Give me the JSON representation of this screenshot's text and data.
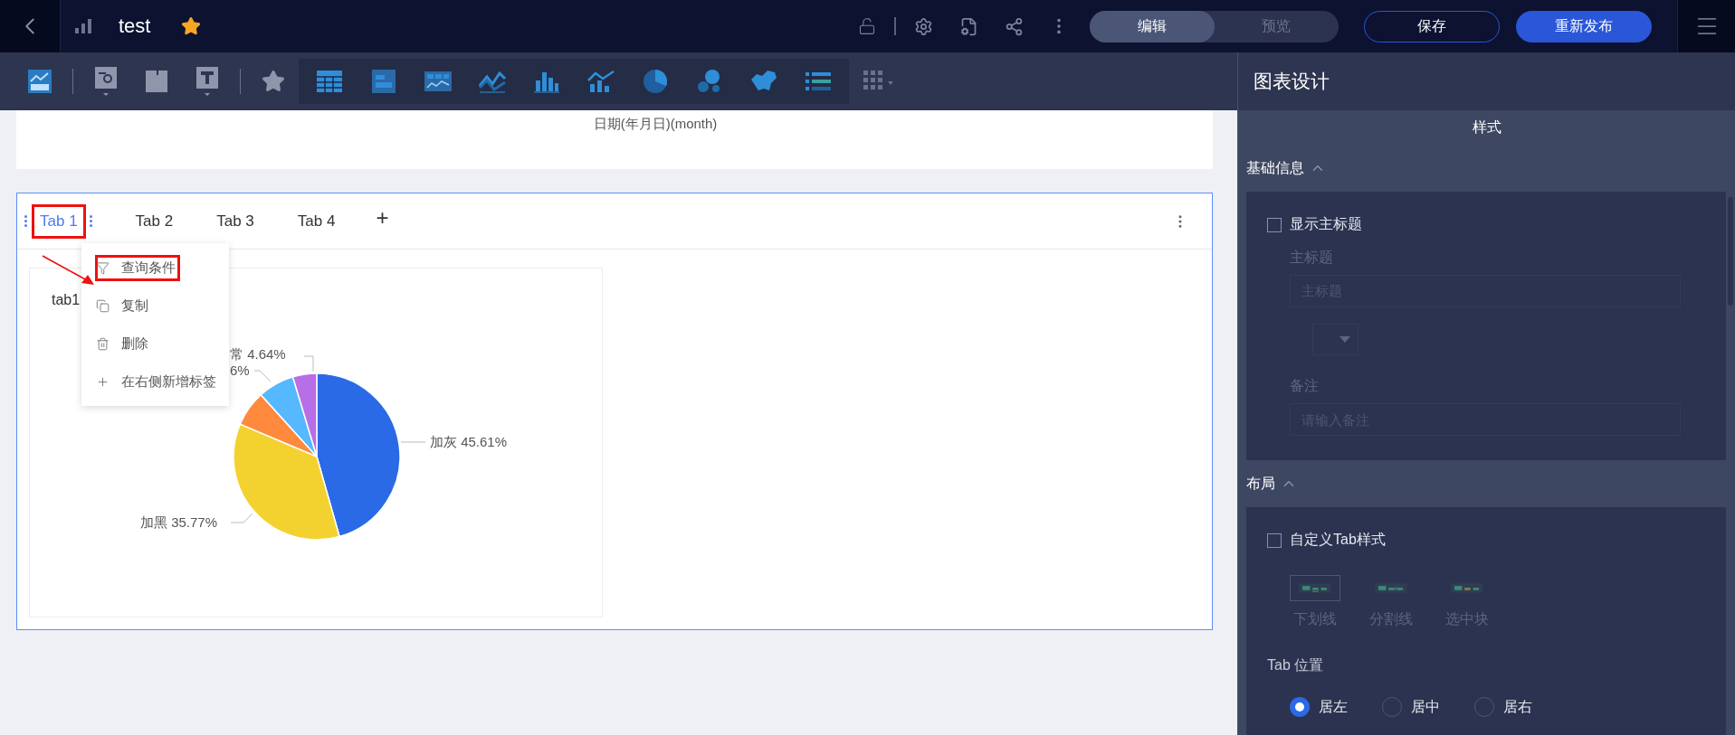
{
  "top_bar": {
    "title": "test",
    "favorite": true,
    "modes": [
      {
        "label": "编辑",
        "selected": true
      },
      {
        "label": "预览",
        "selected": false
      }
    ],
    "buttons": [
      {
        "label": "保存",
        "kind": "outline"
      },
      {
        "label": "重新发布",
        "kind": "primary"
      }
    ]
  },
  "canvas": {
    "axis_title": "日期(年月日)(month)",
    "tab_widget": {
      "tabs": [
        {
          "label": "Tab 1",
          "selected": true,
          "annotated": true
        },
        {
          "label": "Tab 2",
          "selected": false,
          "annotated": false
        },
        {
          "label": "Tab 3",
          "selected": false,
          "annotated": false
        },
        {
          "label": "Tab 4",
          "selected": false,
          "annotated": false
        }
      ],
      "add_label": "+",
      "context_menu": {
        "items": [
          {
            "label": "查询条件",
            "kind": "filter",
            "annotated": true
          },
          {
            "label": "复制",
            "kind": "copy",
            "annotated": false
          },
          {
            "label": "删除",
            "kind": "delete",
            "annotated": false
          },
          {
            "label": "在右侧新增标签",
            "kind": "add",
            "annotated": false
          }
        ]
      },
      "chart": {
        "title": "tab1",
        "labels": [
          "常 4.64%",
          "6%",
          "加灰 45.61%",
          "加黑 35.77%"
        ],
        "slices": [
          {
            "color": "#2a6ae6"
          },
          {
            "color": "#f3d22f"
          },
          {
            "color": "#ff8a3d"
          },
          {
            "color": "#56b8ff"
          },
          {
            "color": "#b86ee6"
          }
        ],
        "chart_data": {
          "type": "pie",
          "values": [
            45.61,
            35.77,
            6.92,
            7.06,
            4.64
          ]
        }
      }
    }
  },
  "panel": {
    "title": "图表设计",
    "tab": "样式",
    "basic_info": {
      "title": "基础信息",
      "expanded": true,
      "show_title": {
        "label": "显示主标题",
        "checked": false
      },
      "title_label": "主标题",
      "title_input": {
        "placeholder": "主标题"
      },
      "note_label": "备注",
      "note_input": {
        "placeholder": "请输入备注"
      }
    },
    "layout": {
      "title": "布局",
      "expanded": true,
      "custom_style": {
        "label": "自定义Tab样式",
        "checked": false
      },
      "styles": [
        {
          "label": "下划线",
          "selected": true
        },
        {
          "label": "分割线",
          "selected": false
        },
        {
          "label": "选中块",
          "selected": false
        }
      ],
      "position_label": "Tab 位置",
      "positions": [
        {
          "label": "居左",
          "selected": true
        },
        {
          "label": "居中",
          "selected": false
        },
        {
          "label": "居右",
          "selected": false
        }
      ]
    }
  }
}
